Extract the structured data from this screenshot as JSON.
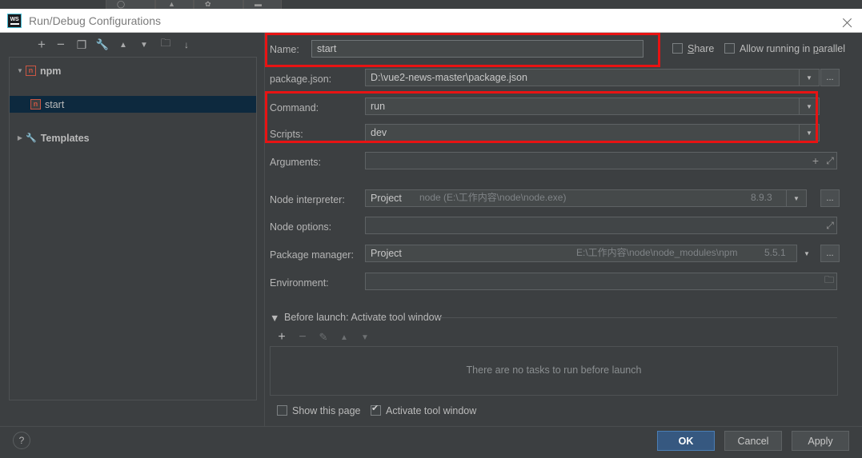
{
  "window": {
    "title": "Run/Debug Configurations",
    "app_icon": "webstorm-icon",
    "app_icon_text": "WS",
    "close_label": "✕"
  },
  "left_toolbar": {
    "buttons": [
      {
        "name": "add-configuration-button",
        "glyph": "+"
      },
      {
        "name": "remove-configuration-button",
        "glyph": "−"
      },
      {
        "name": "copy-configuration-button",
        "glyph": "❐"
      },
      {
        "name": "edit-templates-button",
        "glyph": "🔧"
      },
      {
        "name": "move-up-button",
        "glyph": "▲"
      },
      {
        "name": "move-down-button",
        "glyph": "▼"
      },
      {
        "name": "new-folder-button",
        "glyph": "🗀"
      },
      {
        "name": "sort-configurations-button",
        "glyph": "↓"
      }
    ]
  },
  "tree": {
    "items": [
      {
        "label": "npm",
        "type": "group",
        "expanded": true,
        "twisty": "▼",
        "badge": "n",
        "selected": false
      },
      {
        "label": "start",
        "type": "config",
        "expanded": false,
        "twisty": "",
        "badge": "n",
        "selected": true
      },
      {
        "label": "Templates",
        "type": "templates",
        "expanded": false,
        "twisty": "▶",
        "badge": "",
        "selected": false
      }
    ]
  },
  "form": {
    "name": {
      "label": "Name:",
      "value": "start"
    },
    "share": {
      "label": "Share",
      "mnemonic": "S",
      "checked": false
    },
    "parallel": {
      "label": "Allow running in parallel",
      "mnemonic": "p",
      "checked": false
    },
    "package_json": {
      "label": "package.json:",
      "value": "D:\\vue2-news-master\\package.json",
      "browse_label": "...",
      "arrow": "▼"
    },
    "command": {
      "label": "Command:",
      "value": "run",
      "arrow": "▼"
    },
    "scripts": {
      "label": "Scripts:",
      "value": "dev",
      "arrow": "▼"
    },
    "arguments": {
      "label": "Arguments:",
      "value": "",
      "add_glyph": "+",
      "expand_glyph": "⤢"
    },
    "node_interpreter": {
      "label": "Node interpreter:",
      "value": "Project",
      "hint": "node (E:\\工作内容\\node\\node.exe)",
      "version": "8.9.3",
      "arrow": "▼",
      "browse_label": "..."
    },
    "node_options": {
      "label": "Node options:",
      "value": "",
      "expand_glyph": "⤢"
    },
    "package_manager": {
      "label": "Package manager:",
      "value": "Project",
      "hint": "E:\\工作内容\\node\\node_modules\\npm",
      "version": "5.5.1",
      "arrow": "▼",
      "browse_label": "..."
    },
    "environment": {
      "label": "Environment:",
      "value": "",
      "browse_glyph": "🗀"
    }
  },
  "before_launch": {
    "header": "Before launch: Activate tool window",
    "twisty": "▼",
    "toolbar": [
      {
        "name": "add-task-button",
        "glyph": "+",
        "enabled": true
      },
      {
        "name": "remove-task-button",
        "glyph": "−",
        "enabled": false
      },
      {
        "name": "edit-task-button",
        "glyph": "✎",
        "enabled": false
      },
      {
        "name": "move-task-up-button",
        "glyph": "▲",
        "enabled": false
      },
      {
        "name": "move-task-down-button",
        "glyph": "▼",
        "enabled": false
      }
    ],
    "empty_text": "There are no tasks to run before launch",
    "show_this_page": {
      "label": "Show this page",
      "checked": false
    },
    "activate_tool_window": {
      "label": "Activate tool window",
      "checked": true
    }
  },
  "footer": {
    "help_glyph": "?",
    "ok": "OK",
    "cancel": "Cancel",
    "apply": "Apply"
  },
  "colors": {
    "accent": "#365880",
    "annotation": "#e81313",
    "background": "#3c3f41",
    "field": "#45494a"
  }
}
